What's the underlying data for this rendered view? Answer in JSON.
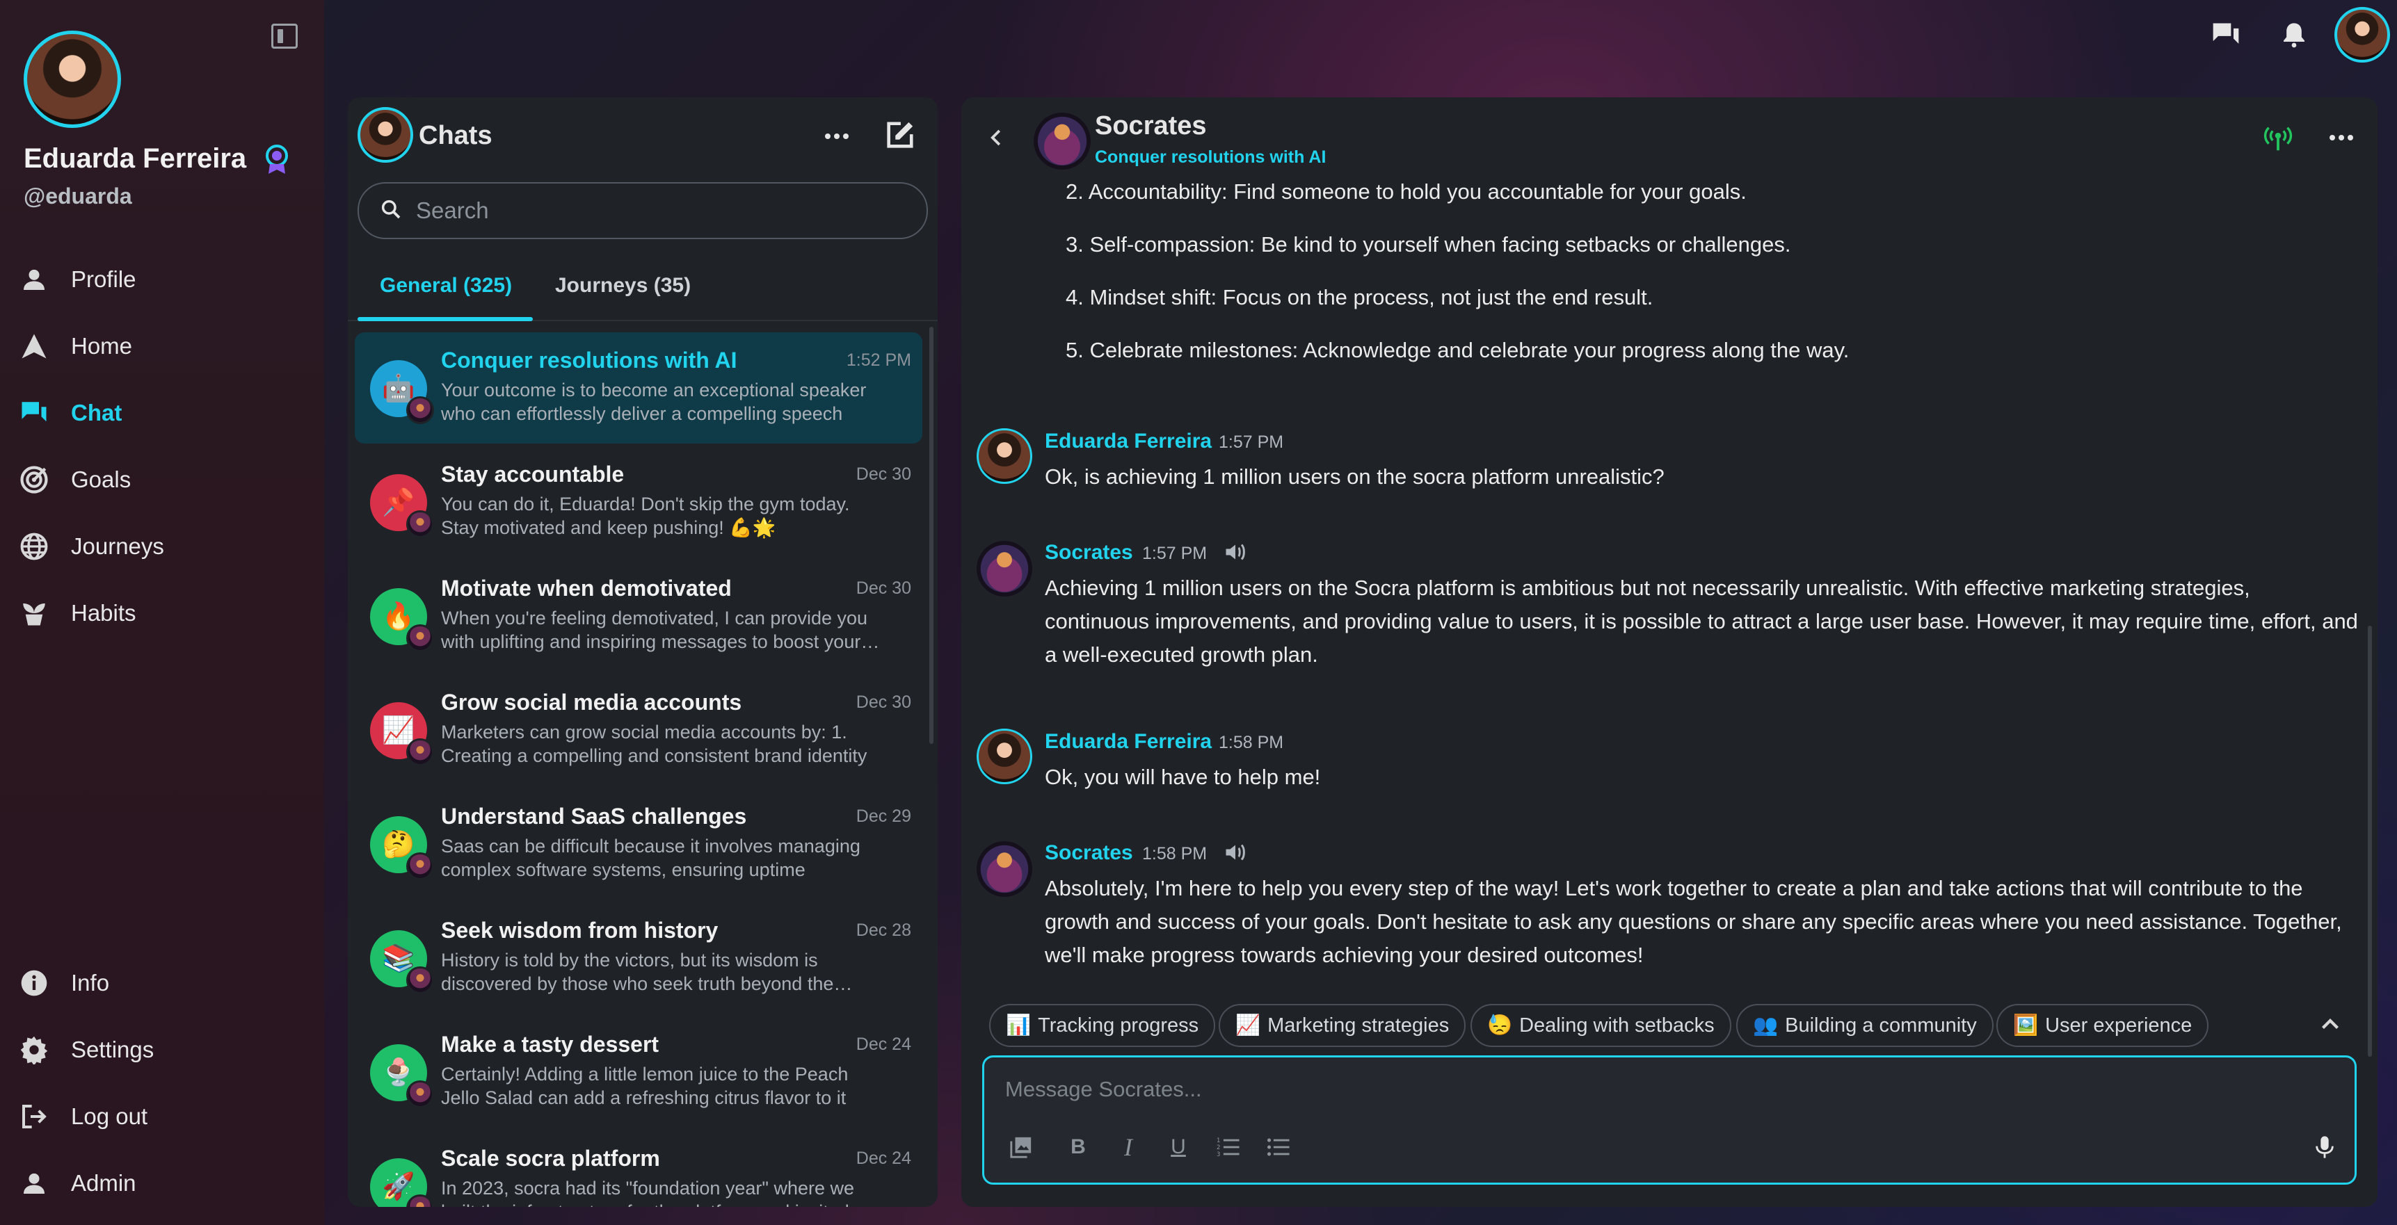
{
  "user": {
    "name": "Eduarda Ferreira",
    "handle": "@eduarda"
  },
  "nav": {
    "main": [
      {
        "label": "Profile",
        "icon": "person-icon"
      },
      {
        "label": "Home",
        "icon": "home-icon"
      },
      {
        "label": "Chat",
        "icon": "chat-icon",
        "active": true
      },
      {
        "label": "Goals",
        "icon": "target-icon"
      },
      {
        "label": "Journeys",
        "icon": "globe-icon"
      },
      {
        "label": "Habits",
        "icon": "plant-icon"
      }
    ],
    "bottom": [
      {
        "label": "Info",
        "icon": "info-icon"
      },
      {
        "label": "Settings",
        "icon": "gear-icon"
      },
      {
        "label": "Log out",
        "icon": "logout-icon"
      },
      {
        "label": "Admin",
        "icon": "person-icon"
      }
    ]
  },
  "chats": {
    "title": "Chats",
    "search_placeholder": "Search",
    "tabs": [
      {
        "label": "General (325)",
        "active": true
      },
      {
        "label": "Journeys (35)"
      }
    ],
    "items": [
      {
        "title": "Conquer resolutions with AI",
        "time": "1:52 PM",
        "preview": "Your outcome is to become an exceptional speaker who can effortlessly deliver a compelling speech",
        "color": "#1fa3d6",
        "emoji": "🤖",
        "active": true
      },
      {
        "title": "Stay accountable",
        "time": "Dec 30",
        "preview": "You can do it, Eduarda! Don't skip the gym today. Stay motivated and keep pushing! 💪🌟",
        "color": "#d9314a",
        "emoji": "📌"
      },
      {
        "title": "Motivate when demotivated",
        "time": "Dec 30",
        "preview": "When you're feeling demotivated, I can provide you with uplifting and inspiring messages to boost your mood",
        "color": "#1fbf6a",
        "emoji": "🔥"
      },
      {
        "title": "Grow social media accounts",
        "time": "Dec 30",
        "preview": "Marketers can grow social media accounts by: 1. Creating a compelling and consistent brand identity",
        "color": "#d9314a",
        "emoji": "📈"
      },
      {
        "title": "Understand SaaS challenges",
        "time": "Dec 29",
        "preview": "Saas can be difficult because it involves managing complex software systems, ensuring uptime",
        "color": "#1fbf6a",
        "emoji": "🤔"
      },
      {
        "title": "Seek wisdom from history",
        "time": "Dec 28",
        "preview": "History is told by the victors, but its wisdom is discovered by those who seek truth beyond the surface",
        "color": "#1fbf6a",
        "emoji": "📚"
      },
      {
        "title": "Make a tasty dessert",
        "time": "Dec 24",
        "preview": "Certainly! Adding a little lemon juice to the Peach Jello Salad can add a refreshing citrus flavor to it",
        "color": "#1fbf6a",
        "emoji": "🍨"
      },
      {
        "title": "Scale socra platform",
        "time": "Dec 24",
        "preview": "In 2023, socra had its \"foundation year\" where we built the infrastructure for the platform and invited",
        "color": "#1fbf6a",
        "emoji": "🚀"
      }
    ]
  },
  "conversation": {
    "title": "Socrates",
    "subtitle": "Conquer resolutions with AI",
    "list": [
      "2. Accountability: Find someone to hold you accountable for your goals.",
      "3. Self-compassion: Be kind to yourself when facing setbacks or challenges.",
      "4. Mindset shift: Focus on the process, not just the end result.",
      "5. Celebrate milestones: Acknowledge and celebrate your progress along the way."
    ],
    "messages": [
      {
        "author": "Eduarda Ferreira",
        "time": "1:57 PM",
        "text": "Ok, is achieving 1 million users on the socra platform unrealistic?"
      },
      {
        "author": "Socrates",
        "time": "1:57 PM",
        "text": "Achieving 1 million users on the Socra platform is ambitious but not necessarily unrealistic. With effective marketing strategies, continuous improvements, and providing value to users, it is possible to attract a large user base. However, it may require time, effort, and a well-executed growth plan."
      },
      {
        "author": "Eduarda Ferreira",
        "time": "1:58 PM",
        "text": "Ok, you will have to help me!"
      },
      {
        "author": "Socrates",
        "time": "1:58 PM",
        "text": "Absolutely, I'm here to help you every step of the way! Let's work together to create a plan and take actions that will contribute to the growth and success of your goals. Don't hesitate to ask any questions or share any specific areas where you need assistance. Together, we'll make progress towards achieving your desired outcomes!"
      }
    ],
    "suggestions": [
      {
        "emoji": "📊",
        "label": "Tracking progress"
      },
      {
        "emoji": "📈",
        "label": "Marketing strategies"
      },
      {
        "emoji": "😓",
        "label": "Dealing with setbacks"
      },
      {
        "emoji": "👥",
        "label": "Building a community"
      },
      {
        "emoji": "🖼️",
        "label": "User experience"
      }
    ],
    "composer_placeholder": "Message Socrates..."
  },
  "colors": {
    "accent": "#22d3ee",
    "panel": "#1f2328",
    "active_chat_bg": "#0f3a47"
  }
}
